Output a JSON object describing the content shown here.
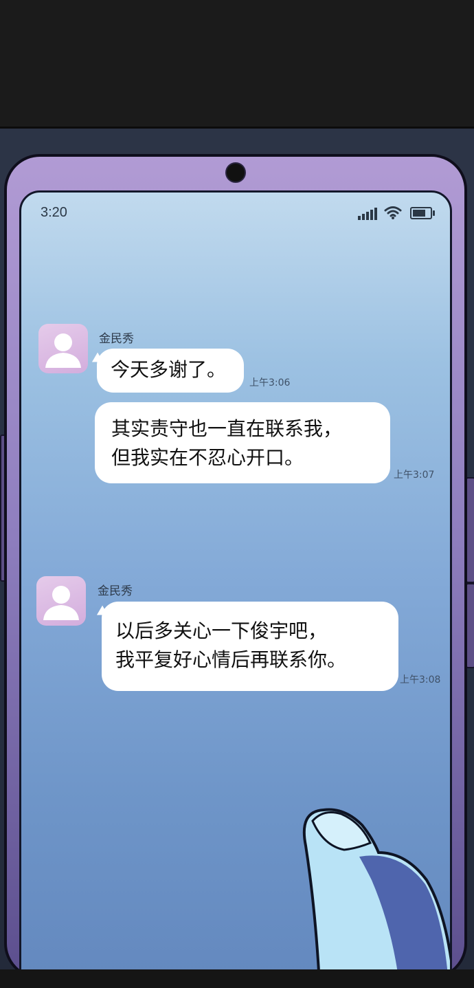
{
  "status_bar": {
    "time": "3:20"
  },
  "messages": [
    {
      "sender": "金民秀",
      "text": "今天多谢了。",
      "time": "上午3:06"
    },
    {
      "text": "其实责守也一直在联系我，\n但我实在不忍心开口。",
      "time": "上午3:07"
    },
    {
      "sender": "金民秀",
      "text": "以后多关心一下俊宇吧，\n我平复好心情后再联系你。",
      "time": "上午3:08"
    }
  ],
  "icons": {
    "avatar": "person-silhouette-icon",
    "signal": "signal-bars-icon",
    "wifi": "wifi-icon",
    "battery": "battery-icon"
  },
  "colors": {
    "bubble": "#ffffff",
    "screen_top": "#c1daee",
    "screen_bottom": "#6489bf",
    "phone_frame": "#9a87c8",
    "avatar": "#dcbbe4"
  }
}
